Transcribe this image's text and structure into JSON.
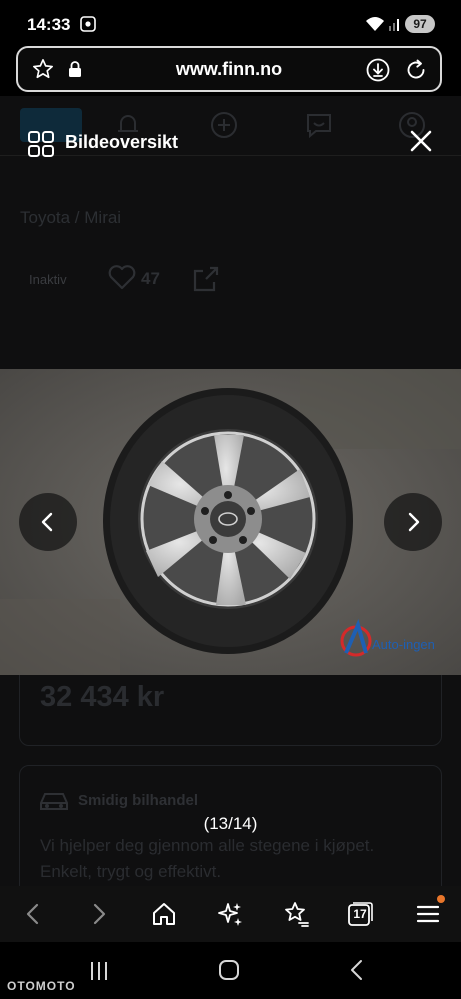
{
  "status_bar": {
    "time": "14:33",
    "battery": "97"
  },
  "browser": {
    "url": "www.finn.no"
  },
  "background_page": {
    "breadcrumb": "Toyota  /  Mirai",
    "ad_status": "Inaktiv",
    "favorites_count": "47",
    "price": "32 434 kr",
    "promo_title": "Smidig bilhandel",
    "promo_line1": "Vi hjelper deg gjennom alle stegene i kjøpet.",
    "promo_line2": "Enkelt, trygt og effektivt."
  },
  "gallery": {
    "title": "Bildeoversikt",
    "counter": "(13/14)",
    "photo_logo_text": "Auto-ingen"
  },
  "toolbar": {
    "tabs_count": "17"
  },
  "watermark": "OTOMOTO"
}
